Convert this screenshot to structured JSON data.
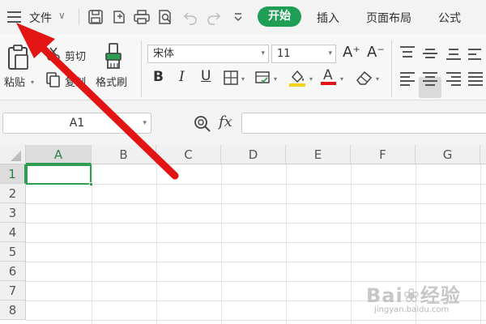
{
  "menubar": {
    "file_label": "文件",
    "tabs": [
      "开始",
      "插入",
      "页面布局",
      "公式"
    ],
    "active_tab_color": "#1f9e55"
  },
  "ribbon": {
    "paste_label": "粘贴",
    "cut_label": "剪切",
    "copy_label": "复制",
    "format_painter_label": "格式刷",
    "font_name": "宋体",
    "font_size": "11",
    "bold": "B",
    "italic": "I",
    "underline": "U",
    "font_color_letter": "A",
    "grow_font": "A⁺",
    "shrink_font": "A⁻"
  },
  "formula_bar": {
    "name_box": "A1",
    "fx_label": "fx",
    "formula": ""
  },
  "grid": {
    "columns": [
      "A",
      "B",
      "C",
      "D",
      "E",
      "F",
      "G"
    ],
    "rows": [
      "1",
      "2",
      "3",
      "4",
      "5",
      "6",
      "7",
      "8"
    ],
    "active_cell": "A1",
    "selection_color": "#2f9e52"
  },
  "watermark": {
    "main": "Bai❀经验",
    "sub": "jingyan.baidu.com"
  },
  "annotation": {
    "arrow_color": "#e31414",
    "points_to": "menu-icon"
  }
}
